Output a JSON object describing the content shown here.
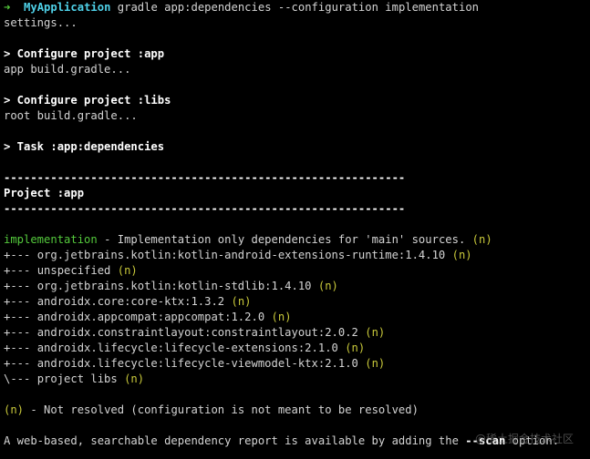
{
  "prompt": {
    "arrow": "➜",
    "dir": "MyApplication",
    "command": "gradle app:dependencies --configuration implementation"
  },
  "lines": {
    "settings": "settings...",
    "configure_app": "> Configure project :app",
    "app_build": "app build.gradle...",
    "configure_libs": "> Configure project :libs",
    "root_build": "root build.gradle...",
    "task": "> Task :app:dependencies",
    "separator": "------------------------------------------------------------",
    "project": "Project :app"
  },
  "config": {
    "name": "implementation",
    "description": " - Implementation only dependencies for 'main' sources. ",
    "marker": "(n)"
  },
  "dependencies": [
    {
      "prefix": "+--- ",
      "name": "org.jetbrains.kotlin:kotlin-android-extensions-runtime:1.4.10",
      "marker": "(n)"
    },
    {
      "prefix": "+--- ",
      "name": "unspecified",
      "marker": "(n)"
    },
    {
      "prefix": "+--- ",
      "name": "org.jetbrains.kotlin:kotlin-stdlib:1.4.10",
      "marker": "(n)"
    },
    {
      "prefix": "+--- ",
      "name": "androidx.core:core-ktx:1.3.2",
      "marker": "(n)"
    },
    {
      "prefix": "+--- ",
      "name": "androidx.appcompat:appcompat:1.2.0",
      "marker": "(n)"
    },
    {
      "prefix": "+--- ",
      "name": "androidx.constraintlayout:constraintlayout:2.0.2",
      "marker": "(n)"
    },
    {
      "prefix": "+--- ",
      "name": "androidx.lifecycle:lifecycle-extensions:2.1.0",
      "marker": "(n)"
    },
    {
      "prefix": "+--- ",
      "name": "androidx.lifecycle:lifecycle-viewmodel-ktx:2.1.0",
      "marker": "(n)"
    },
    {
      "prefix": "\\--- ",
      "name": "project libs",
      "marker": "(n)"
    }
  ],
  "legend": {
    "marker": "(n)",
    "text": " - Not resolved (configuration is not meant to be resolved)"
  },
  "footer": {
    "before": "A web-based, searchable dependency report is available by adding the ",
    "flag": "--scan",
    "after": " option."
  },
  "watermark": "@稀土掘金技术社区",
  "colors": {
    "background": "#000000",
    "text": "#d4d4d4",
    "green": "#54c93c",
    "yellow": "#c8c83a",
    "cyan": "#4fd1e8"
  }
}
